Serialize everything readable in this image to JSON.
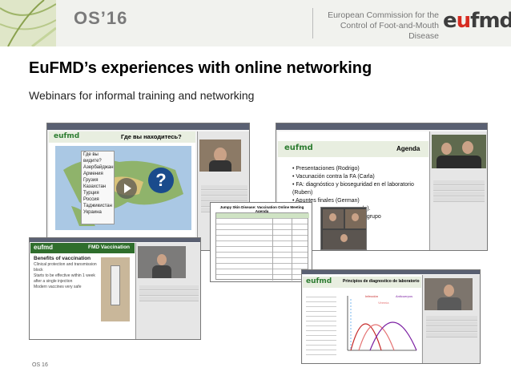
{
  "header": {
    "event": "OS’16",
    "commission": "European Commission for the Control of Foot-and-Mouth Disease",
    "logo_pre": "e",
    "logo_u": "u",
    "logo_post": "fmd"
  },
  "title": "EuFMD’s experiences with online networking",
  "subtitle": "Webinars for informal training and networking",
  "shot1": {
    "slide_title": "Где вы находитесь?",
    "brand": "eufmd",
    "menu_items": [
      "Где вы видите?",
      "Азербайджан",
      "Армения",
      "Грузия",
      "Казахстан",
      "Турция",
      "Россия",
      "Таджикистан",
      "Украина"
    ]
  },
  "shot2": {
    "slide_title": "Agenda",
    "brand": "eufmd",
    "bullets": [
      "Presentaciones (Rodrigo)",
      "Vacunación contra la FA (Carla)",
      "FA: diagnóstico y bioseguridad en el laboratorio (Ruben)",
      "Apuntes finales (German)",
      "…(o).",
      "…n grupo"
    ]
  },
  "shot3": {
    "brand": "eufmd",
    "slide_title": "FMD Vaccination",
    "heading": "Benefits of vaccination",
    "lines": [
      "Clinical protection and transmission block",
      "Starts to be effective within 1 week after a single injection",
      "Modern vaccines very safe"
    ]
  },
  "shot4": {
    "title": "Jumpy Skin Disease: Vaccination Online Meeting Agenda"
  },
  "shot5": {
    "brand": "eufmd",
    "slide_title": "Principios de diagnostico de laboratorio",
    "labels": [
      "Infección",
      "Viremia",
      "Anticuerpos"
    ]
  },
  "footer": "OS 16"
}
